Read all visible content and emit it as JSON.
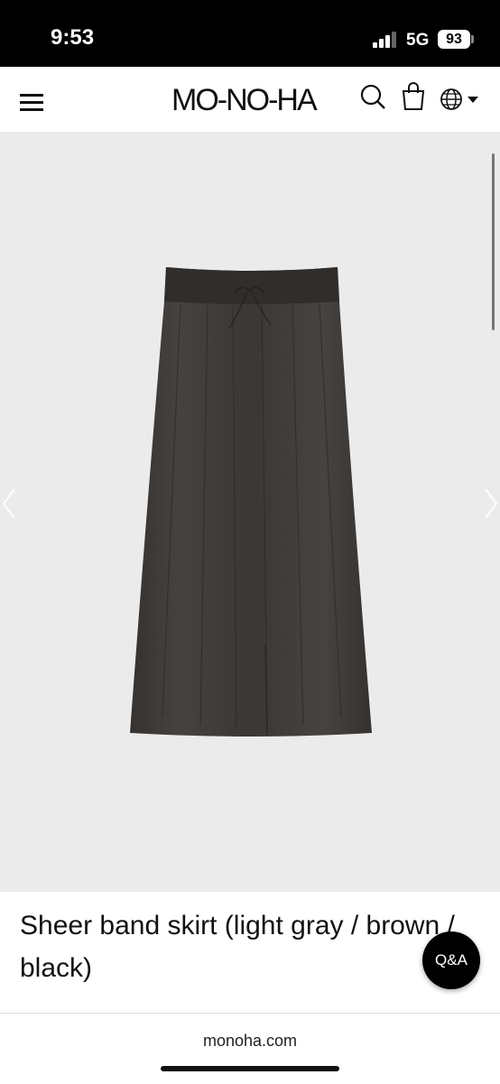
{
  "status_bar": {
    "time": "9:53",
    "network": "5G",
    "battery": "93"
  },
  "header": {
    "logo": "MO-NO-HA"
  },
  "icons": {
    "menu": "menu-icon",
    "search": "search-icon",
    "cart": "shopping-bag-icon",
    "language": "globe-icon",
    "prev": "chevron-left-icon",
    "next": "chevron-right-icon"
  },
  "product": {
    "title": "Sheer band skirt (light gray / brown / black)"
  },
  "qa_button": {
    "label": "Q&A"
  },
  "browser": {
    "url": "monoha.com"
  },
  "colors": {
    "status_bar": "#000000",
    "gallery_bg": "#ebebeb",
    "skirt": "#3e3b39",
    "qa_button": "#000000"
  }
}
